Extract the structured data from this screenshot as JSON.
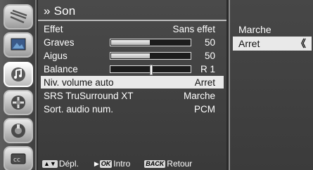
{
  "menu": {
    "title": "Son",
    "title_prefix": "»",
    "rows": [
      {
        "label": "Effet",
        "value": "Sans effet"
      },
      {
        "label": "Graves",
        "value": "50",
        "level": 50
      },
      {
        "label": "Aigus",
        "value": "50",
        "level": 50
      },
      {
        "label": "Balance",
        "value": "R 1",
        "balance": 1
      },
      {
        "label": "Niv. volume auto",
        "value": "Arret"
      },
      {
        "label": "SRS TruSurround XT",
        "value": "Marche"
      },
      {
        "label": "Sort. audio num.",
        "value": "PCM"
      }
    ]
  },
  "submenu": {
    "options": [
      "Marche",
      "Arret"
    ],
    "selected_index": 1,
    "chevron": "《"
  },
  "footer": {
    "move_keys": "▲▼",
    "move_label": "Dépl.",
    "ok_key_prefix": "▶",
    "ok_key": "OK",
    "ok_label": "Intro",
    "back_key": "BACK",
    "back_label": "Retour"
  },
  "icons": [
    "picture-settings-icon",
    "picture-icon",
    "sound-icon",
    "channel-icon",
    "setup-icon",
    "input-icon"
  ],
  "colors": {
    "highlight": "#e9e9e9",
    "panel": "#3f3f3f"
  }
}
